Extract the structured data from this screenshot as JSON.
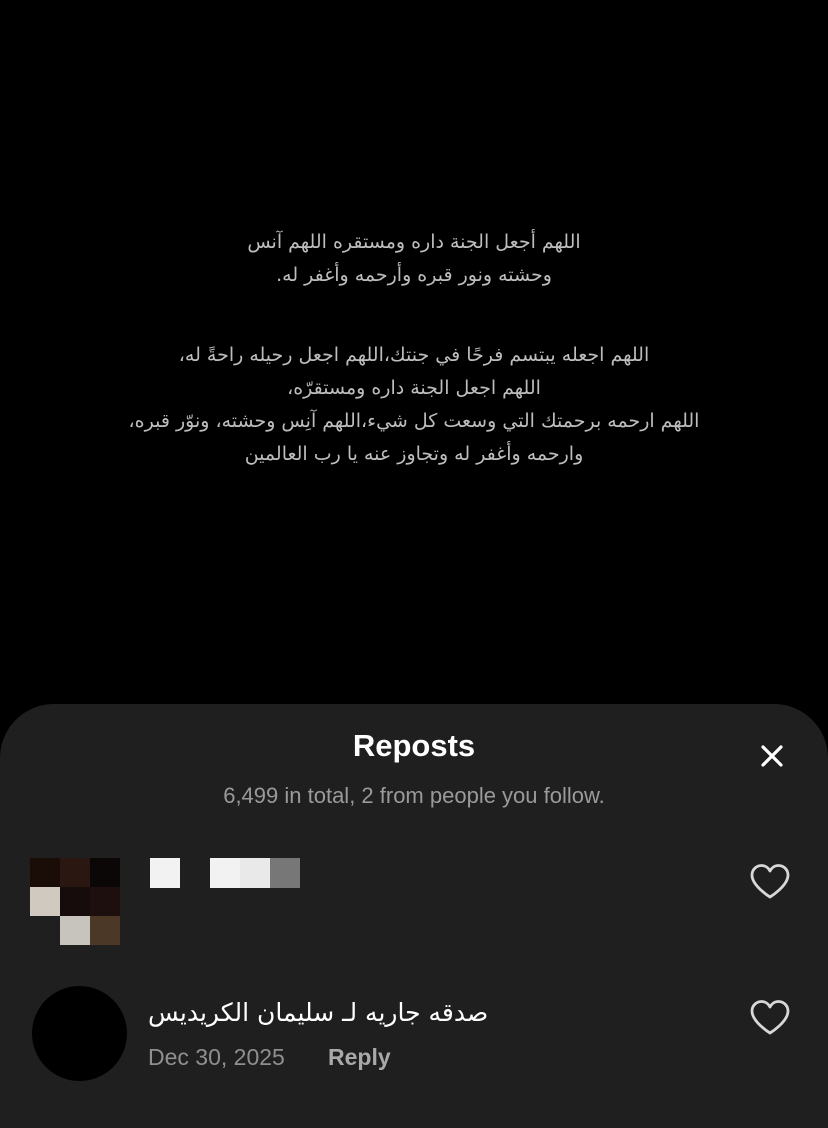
{
  "video": {
    "verse_1": [
      "اللهم أجعل الجنة داره ومستقره اللهم آنس",
      "وحشته ونور قبره وأرحمه وأغفر له."
    ],
    "verse_2": [
      "اللهم اجعله يبتسم فرحًا في جنتك،اللهم اجعل رحيله راحةً له،",
      "اللهم اجعل الجنة داره ومستقرّه،",
      "اللهم ارحمه برحمتك التي وسعت كل شيء،اللهم آنِس وحشته، ونوّر قبره،",
      "وارحمه وأغفر له وتجاوز عنه يا رب العالمين"
    ]
  },
  "sheet": {
    "title": "Reposts",
    "subtitle": "6,499 in total, 2 from people you follow.",
    "close_icon": "close-icon"
  },
  "rows": [
    {
      "avatar_icon": "pixelated-avatar",
      "heart_icon": "heart-outline-icon"
    },
    {
      "avatar_icon": "black-avatar",
      "comment": "صدقه جاريه لـ سليمان الكريديس",
      "date": "Dec 30, 2025",
      "reply_label": "Reply",
      "heart_icon": "heart-outline-icon"
    }
  ],
  "colors": {
    "background": "#000000",
    "sheet": "#1f1f1f",
    "text_primary": "#ffffff",
    "text_secondary": "#9a9a9a"
  }
}
